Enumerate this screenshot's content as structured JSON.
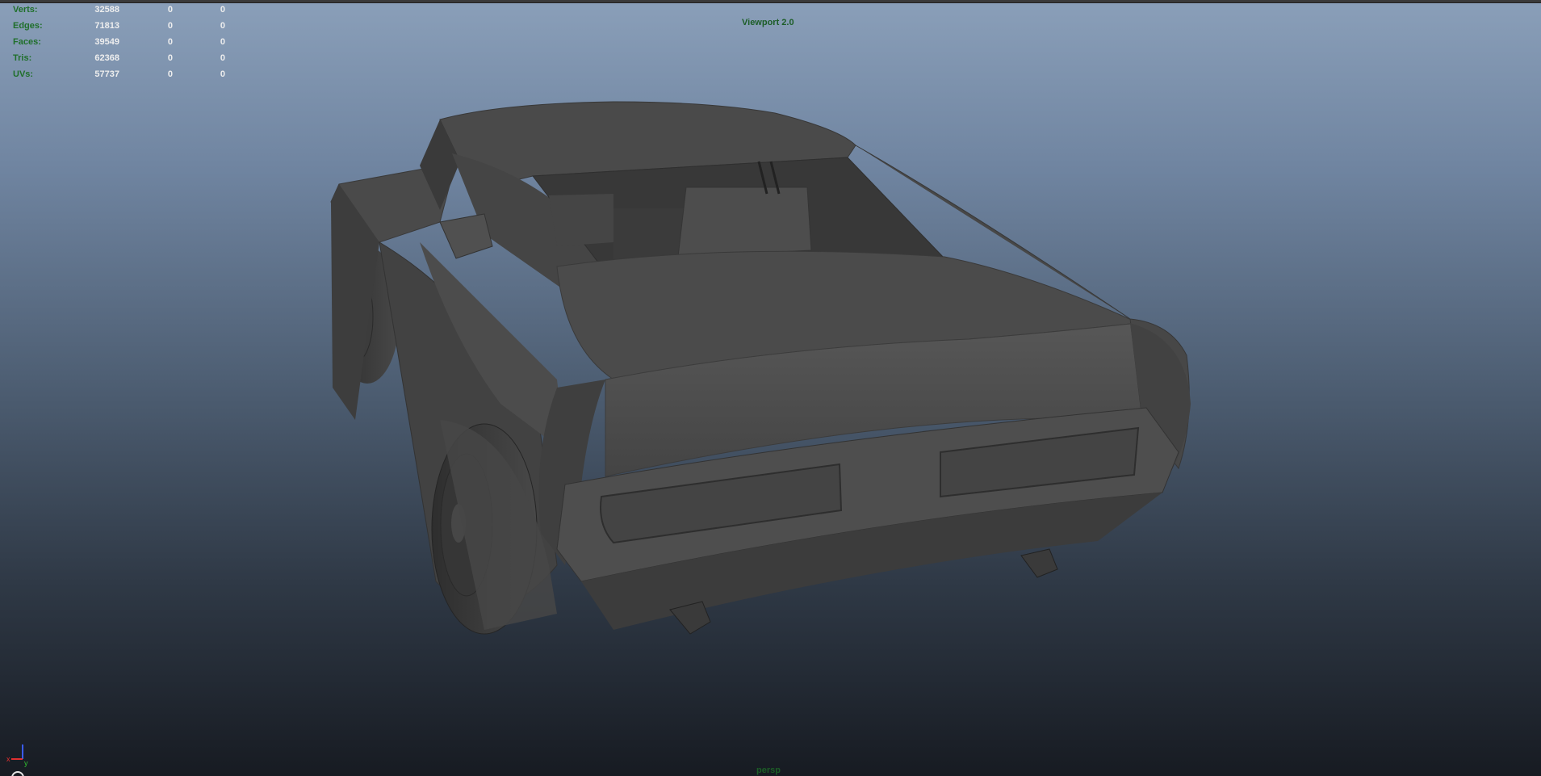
{
  "hud": {
    "rows": [
      {
        "label": "Verts:",
        "values": [
          "32588",
          "0",
          "0"
        ]
      },
      {
        "label": "Edges:",
        "values": [
          "71813",
          "0",
          "0"
        ]
      },
      {
        "label": "Faces:",
        "values": [
          "39549",
          "0",
          "0"
        ]
      },
      {
        "label": "Tris:",
        "values": [
          "62368",
          "0",
          "0"
        ]
      },
      {
        "label": "UVs:",
        "values": [
          "57737",
          "0",
          "0"
        ]
      }
    ]
  },
  "viewport": {
    "title": "Viewport 2.0",
    "camera": "persp"
  },
  "axis_gizmo": {
    "x_label": "x",
    "y_label": "y"
  },
  "colors": {
    "hud_label": "#1f6f2a",
    "hud_value": "#eeeeee",
    "model_shade": "#4a4a4a"
  },
  "icons": [
    "axis-gizmo-icon"
  ]
}
